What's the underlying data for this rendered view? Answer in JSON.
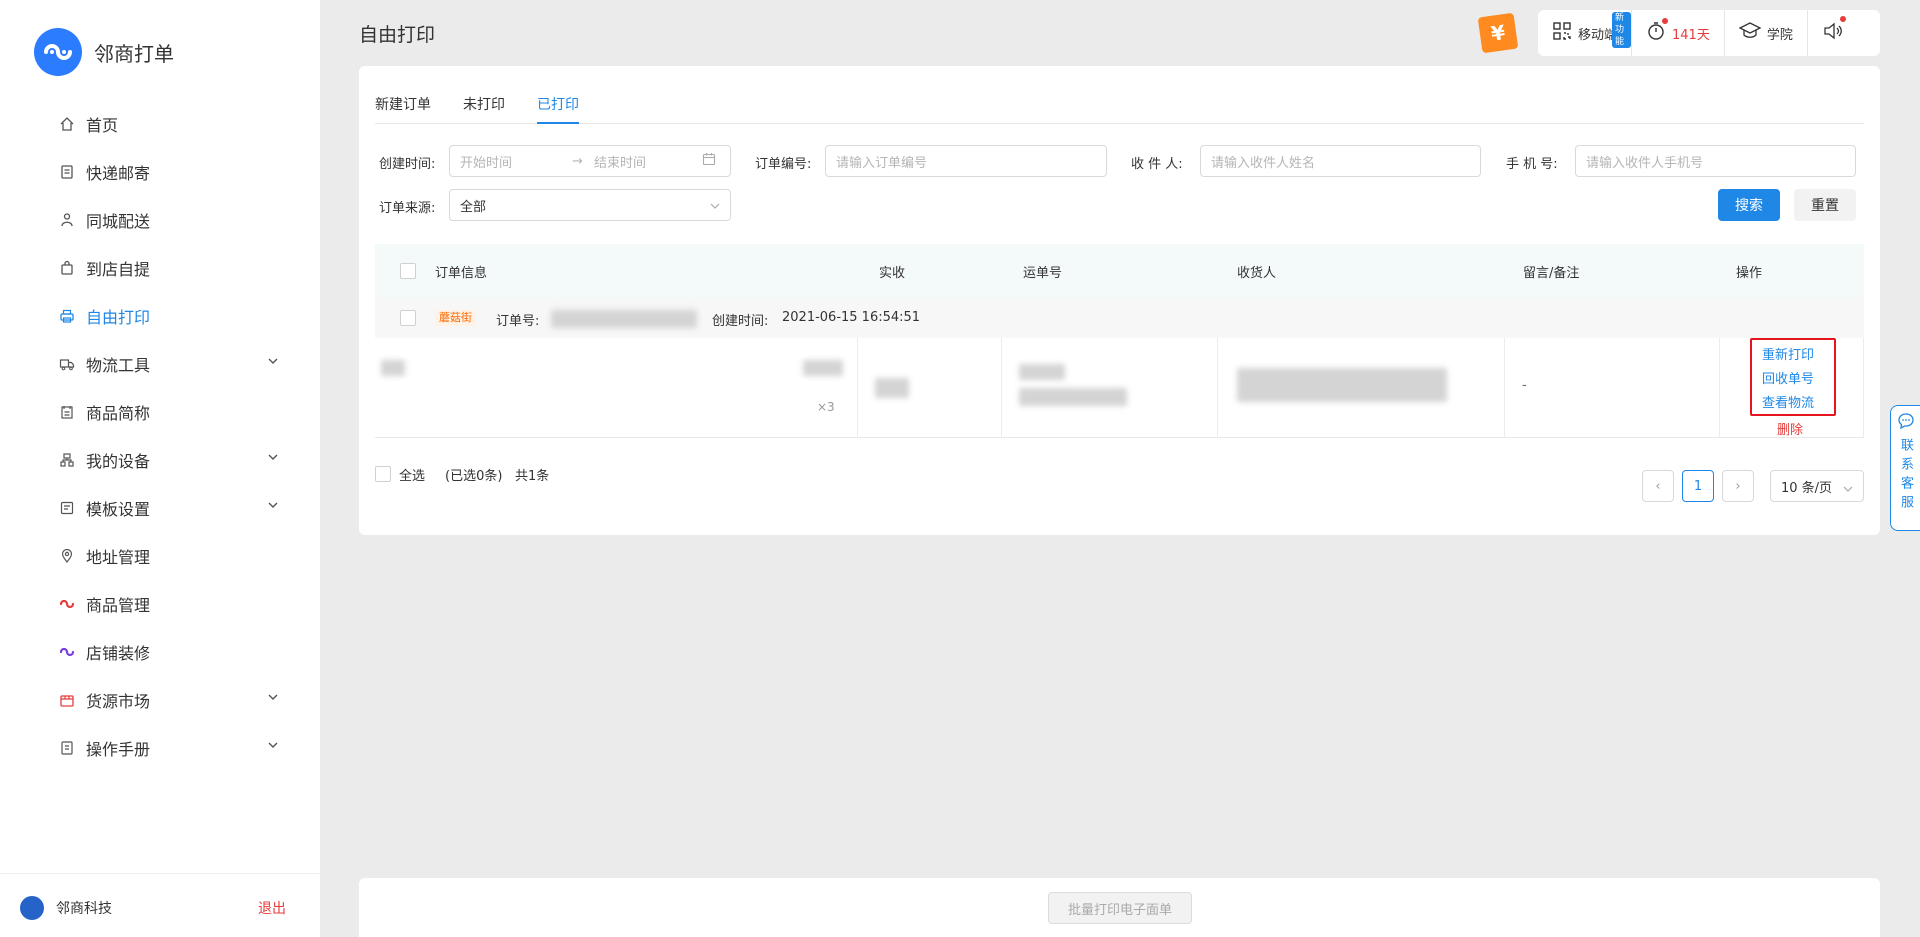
{
  "brand": {
    "name": "邻商打单"
  },
  "sidebar": {
    "items": [
      {
        "label": "首页",
        "icon": "home-icon"
      },
      {
        "label": "快递邮寄",
        "icon": "document-icon"
      },
      {
        "label": "同城配送",
        "icon": "courier-icon"
      },
      {
        "label": "到店自提",
        "icon": "bag-icon"
      },
      {
        "label": "自由打印",
        "icon": "printer-icon",
        "active": true
      },
      {
        "label": "物流工具",
        "icon": "truck-icon",
        "expandable": true
      },
      {
        "label": "商品简称",
        "icon": "tag-icon"
      },
      {
        "label": "我的设备",
        "icon": "device-icon",
        "expandable": true
      },
      {
        "label": "模板设置",
        "icon": "template-icon",
        "expandable": true
      },
      {
        "label": "地址管理",
        "icon": "location-icon"
      },
      {
        "label": "商品管理",
        "icon": "product-icon"
      },
      {
        "label": "店铺装修",
        "icon": "shop-icon"
      },
      {
        "label": "货源市场",
        "icon": "market-icon",
        "expandable": true
      },
      {
        "label": "操作手册",
        "icon": "manual-icon",
        "expandable": true
      }
    ],
    "footer": {
      "company": "邻商科技",
      "logout": "退出"
    }
  },
  "header": {
    "title": "自由打印",
    "coin_label": "¥",
    "mobile": {
      "label": "移动端",
      "badge": "新功能"
    },
    "days": {
      "value": "141天"
    },
    "academy": {
      "label": "学院"
    }
  },
  "tabs": [
    {
      "label": "新建订单"
    },
    {
      "label": "未打印"
    },
    {
      "label": "已打印",
      "active": true
    }
  ],
  "filters": {
    "created_label": "创建时间:",
    "start_placeholder": "开始时间",
    "end_placeholder": "结束时间",
    "order_no_label": "订单编号:",
    "order_no_placeholder": "请输入订单编号",
    "receiver_label": "收 件 人:",
    "receiver_placeholder": "请输入收件人姓名",
    "phone_label": "手 机 号:",
    "phone_placeholder": "请输入收件人手机号",
    "source_label": "订单来源:",
    "source_value": "全部",
    "search_button": "搜索",
    "reset_button": "重置"
  },
  "table": {
    "columns": [
      "订单信息",
      "实收",
      "运单号",
      "收货人",
      "留言/备注",
      "操作"
    ],
    "order": {
      "tag": "蘑菇街",
      "order_no_label": "订单号:",
      "created_label": "创建时间:",
      "created_value": "2021-06-15 16:54:51",
      "quantity": "×3",
      "remark": "-"
    },
    "actions": {
      "reprint": "重新打印",
      "recycle": "回收单号",
      "track": "查看物流",
      "delete": "删除"
    }
  },
  "footer": {
    "select_all": "全选",
    "selected_info": "(已选0条)",
    "total": "共1条",
    "current_page": "1",
    "page_size": "10 条/页"
  },
  "batch_print": "批量打印电子面单",
  "service": {
    "label": "联系客服"
  },
  "colors": {
    "accent": "#1f88e6",
    "danger": "#e63c3c",
    "highlight_box": "#e6141e"
  }
}
